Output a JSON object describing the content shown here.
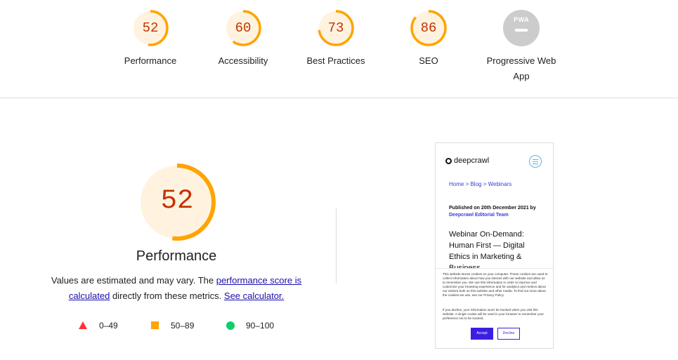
{
  "gauges": [
    {
      "score": "52",
      "label": "Performance",
      "value": 52,
      "color": "#ffa400"
    },
    {
      "score": "60",
      "label": "Accessibility",
      "value": 60,
      "color": "#ffa400"
    },
    {
      "score": "73",
      "label": "Best Practices",
      "value": 73,
      "color": "#ffa400"
    },
    {
      "score": "86",
      "label": "SEO",
      "value": 86,
      "color": "#ffa400"
    },
    {
      "score": "PWA",
      "label_line1": "Progressive Web",
      "label_line2": "App",
      "color": "#cccccc"
    }
  ],
  "performance": {
    "score": "52",
    "value": 52,
    "title": "Performance",
    "desc_text1": "Values are estimated and may vary. The ",
    "desc_link1": "performance score is calculated",
    "desc_text2": " directly from these metrics. ",
    "desc_link2": "See calculator."
  },
  "legend": [
    {
      "range": "0–49",
      "color": "#ff3333",
      "shape": "triangle"
    },
    {
      "range": "50–89",
      "color": "#ffa400",
      "shape": "square"
    },
    {
      "range": "90–100",
      "color": "#0cce6b",
      "shape": "circle"
    }
  ],
  "screenshot": {
    "logo": "deepcrawl",
    "breadcrumb": "Home > Blog > Webinars",
    "published": "Published on 20th December 2021 by",
    "author": "Deepcrawl Editorial Team",
    "title": "Webinar On-Demand: Human First — Digital Ethics in Marketing & Business",
    "cookie_text1": "This website stores cookies on your computer. These cookies are used to collect information about how you interact with our website and allow us to remember you. We use this information in order to improve and customize your browsing experience and for analytics and metrics about our visitors both on this website and other media. To find out more about the cookies we use, see our Privacy Policy.",
    "cookie_text2": "If you decline, your information won't be tracked when you visit this website. A single cookie will be used in your browser to remember your preference not to be tracked.",
    "accept_label": "Accept",
    "decline_label": "Decline"
  }
}
